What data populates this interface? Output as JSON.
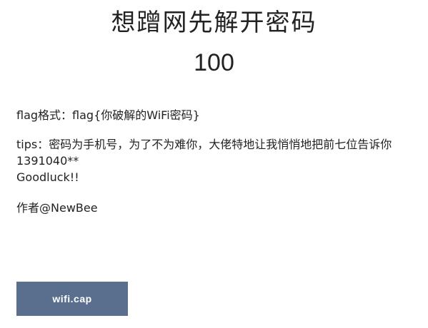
{
  "challenge": {
    "title": "想蹭网先解开密码",
    "points": "100",
    "description": {
      "flag_format": "flag格式：flag{你破解的WiFi密码}",
      "tips": "tips：密码为手机号，为了不为难你，大佬特地让我悄悄地把前七位告诉你",
      "partial_number": "1391040**",
      "goodluck": "Goodluck!!",
      "author": "作者@NewBee"
    },
    "file_button_label": "wifi.cap",
    "colors": {
      "button_bg": "#5a6f8e",
      "text": "#222222"
    }
  }
}
